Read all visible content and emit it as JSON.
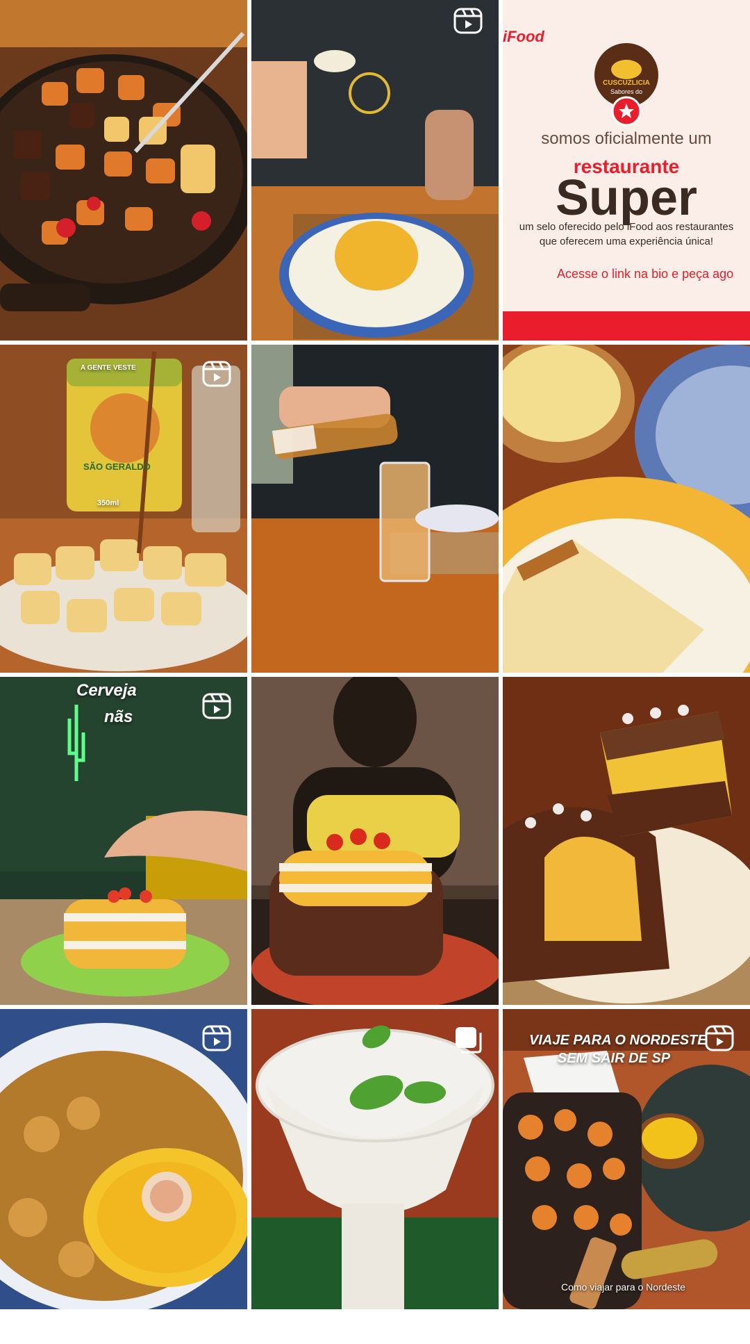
{
  "grid": {
    "tiles": [
      {
        "id": "tile-1",
        "type": "photo",
        "subject": "beef and sweet potato skillet"
      },
      {
        "id": "tile-2",
        "type": "reel",
        "subject": "cuscuz plate"
      },
      {
        "id": "tile-3",
        "type": "post",
        "subject": "ifood super badge announcement"
      },
      {
        "id": "tile-4",
        "type": "reel",
        "subject": "fried cubes with drink can"
      },
      {
        "id": "tile-5",
        "type": "photo",
        "subject": "pouring drink"
      },
      {
        "id": "tile-6",
        "type": "photo",
        "subject": "cake slice on plate"
      },
      {
        "id": "tile-7",
        "type": "reel",
        "subject": "layered cuscuz on green plate"
      },
      {
        "id": "tile-8",
        "type": "photo",
        "subject": "layered cuscuz with statue"
      },
      {
        "id": "tile-9",
        "type": "photo",
        "subject": "coconut cake"
      },
      {
        "id": "tile-10",
        "type": "reel",
        "subject": "shrimp curry with cuscuz"
      },
      {
        "id": "tile-11",
        "type": "multi",
        "subject": "white dessert glass"
      },
      {
        "id": "tile-12",
        "type": "reel",
        "subject": "nordeste spread"
      }
    ]
  },
  "promo": {
    "brand_name": "CUSCUZLICIA",
    "brand_sub": "Sabores do",
    "ifood": "iFood",
    "line1": "somos oficialmente um",
    "line2": "restaurante",
    "line3": "Super",
    "line4": "um selo oferecido pelo iFood aos restaurantes",
    "line5": "que oferecem uma experiência única!",
    "line6": "Acesse o link na bio e peça ago"
  },
  "can": {
    "brand": "SÃO GERALDO",
    "top": "A GENTE VESTE",
    "ml": "350ml"
  },
  "neon": {
    "text1": "Cerveja",
    "text2": "nãs"
  },
  "nordeste": {
    "title1": "VIAJE PARA O NORDESTE",
    "title2": "SEM SAIR DE SP",
    "caption": "Como viajar para o Nordeste"
  },
  "colors": {
    "ifood_red": "#ea1d2c",
    "promo_bg": "#fbeee8",
    "brand_brown": "#5a2d16"
  }
}
